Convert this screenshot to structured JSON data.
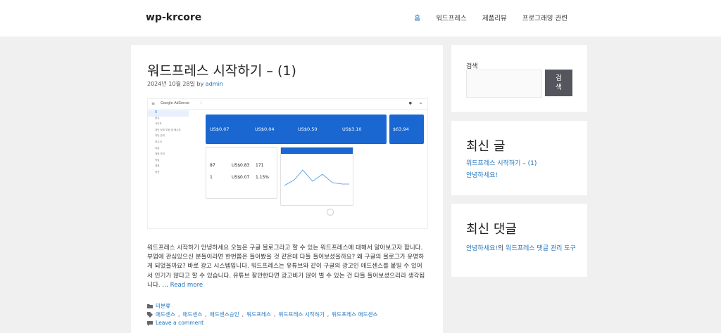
{
  "site": {
    "title": "wp-krcore"
  },
  "nav": {
    "items": [
      "홈",
      "워드프레스",
      "제품리뷰",
      "프로그래밍 관련"
    ],
    "active": "홈"
  },
  "post": {
    "title": "워드프레스 시작하기 – (1)",
    "date": "2024년 10월 28일",
    "by": "by",
    "author": "admin",
    "excerpt": "워드프레스 시작하기 안녕하세요 오늘은 구글 블로그라고 할 수 있는 워드프레스에 대해서 알아보고자 합니다. 부업에 관심있으신 분들이라면 한번쯤은 들어봤을 것 같은데 다들 들어보셨을까요? 왜 구글의 블로그가 유명하게 되었을까요? 바로 광고 시스템입니다. 워드프레스는 유튜브와 같이 구글의 광고인 애드센스를 붙일 수 있어서 인기가 많다고 할 수 있습니다. 유튜브 잘만한다면 광고비가 많이 벌 수 있는 건 다들 들어보셨으리라 생각됩니다. … ",
    "read_more": "Read more",
    "category": "미분류",
    "tags": [
      "애드센스",
      "애드센스",
      "애드센스승인",
      "워드프레스",
      "워드프레스 시작하기",
      "워드프레스 애드센스"
    ],
    "comment_link": "Leave a comment"
  },
  "adsense": {
    "logo": "Google AdSense",
    "menu": [
      "홈",
      "광고",
      "사이트",
      "개인 정보 보호 및 메시지",
      "차단 관리",
      "보고서",
      "지급",
      "계정 관리",
      "작업",
      "계정",
      "의견"
    ],
    "cards": [
      "US$0.07",
      "US$0.04",
      "US$0.50",
      "US$3.10",
      "$63.94"
    ],
    "stats": [
      {
        "label": "페이지뷰",
        "value": "87"
      },
      {
        "label": "페이지 RPM",
        "value": "US$0.83"
      },
      {
        "label": "노출수",
        "value": "171"
      },
      {
        "label": "클릭수",
        "value": "1"
      },
      {
        "label": "CPC",
        "value": "US$0.07"
      },
      {
        "label": "페이지 CTR",
        "value": "1.15%"
      }
    ]
  },
  "sidebar": {
    "search": {
      "label": "검색",
      "button": "검\n색",
      "placeholder": ""
    },
    "recent_posts": {
      "title": "최신 글",
      "items": [
        "워드프레스 시작하기 – (1)",
        "안녕하세요!"
      ]
    },
    "recent_comments": {
      "title": "최신 댓글",
      "commenter": "안녕하세요!",
      "connector": "의 ",
      "post": "워드프레스 댓글 관리 도구"
    }
  },
  "colors": {
    "link": "#1e73be",
    "search_button": "#55555e",
    "adsense_blue": "#1a67d2"
  }
}
